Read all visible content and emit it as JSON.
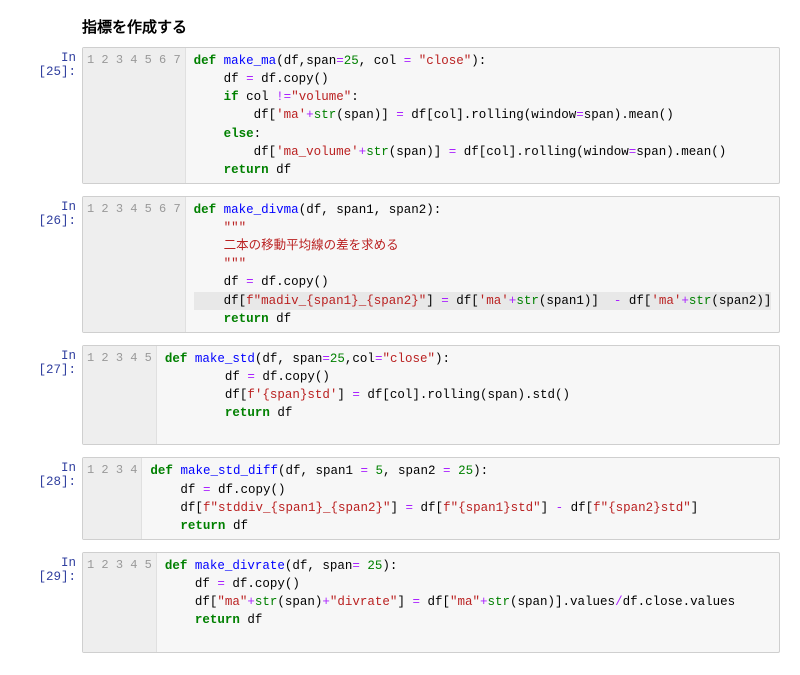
{
  "heading": "指標を作成する",
  "cells": [
    {
      "prompt": "In [25]:",
      "lines": [
        "1",
        "2",
        "3",
        "4",
        "5",
        "6",
        "7"
      ],
      "tokens": {
        "def": "def",
        "name": "make_ma",
        "sig_open": "(df,span",
        "eq1": "=",
        "arg25": "25",
        "argcol": ", col ",
        "eq2": "=",
        "close": " \"close\"",
        "sig_close": "):",
        "l2a": "    df ",
        "eq3": "=",
        "l2b": " df.copy()",
        "if": "    if",
        "l3a": " col ",
        "ne": "!=",
        "volstr": "\"volume\"",
        "colon": ":",
        "l4a": "        df[",
        "mastr": "'ma'",
        "plus": "+",
        "strcall": "str",
        "l4b": "(span)] ",
        "eq4": "=",
        "l4c": " df[col].rolling(window",
        "eq5": "=",
        "l4d": "span).mean()",
        "else": "    else",
        "l6a": "        df[",
        "mavol": "'ma_volume'",
        "l6b": "(span)] ",
        "l6c": " df[col].rolling(window",
        "l6d": "span).mean()",
        "ret": "    return",
        "retv": " df"
      }
    },
    {
      "prompt": "In [26]:",
      "lines": [
        "1",
        "2",
        "3",
        "4",
        "5",
        "6",
        "7"
      ],
      "tokens": {
        "def": "def",
        "name": "make_divma",
        "sig": "(df, span1, span2):",
        "doc1": "    \"\"\"",
        "docj": "    二本の移動平均線の差を求める",
        "doc2": "    \"\"\"",
        "l5a": "    df ",
        "eq": "=",
        "l5b": " df.copy()",
        "l6a": "    df[",
        "fstr": "f\"madiv_",
        "br1": "{span1}",
        "us": "_",
        "br2": "{span2}",
        "fend": "\"",
        "l6b": "] ",
        "l6c": " df[",
        "ma": "'ma'",
        "plus": "+",
        "str": "str",
        "sp1": "(span1)]  ",
        "minus": "-",
        "sp2a": " df[",
        "sp2": "(span2)]",
        "ret": "    return",
        "retv": " df"
      }
    },
    {
      "prompt": "In [27]:",
      "lines": [
        "1",
        "2",
        "3",
        "4",
        "5"
      ],
      "tokens": {
        "def": "def",
        "name": "make_std",
        "sig_open": "(df, span",
        "eq1": "=",
        "n25": "25",
        "sig_mid": ",col",
        "eq2": "=",
        "close": "\"close\"",
        "sig_close": "):",
        "l2a": "        df ",
        "eq3": "=",
        "l2b": " df.copy()",
        "l3a": "        df[",
        "fstr": "f'",
        "br": "{span}",
        "std": "std'",
        "l3b": "] ",
        "eq4": "=",
        "l3c": " df[col].rolling(span).std()",
        "ret": "        return",
        "retv": " df",
        "blank": " "
      }
    },
    {
      "prompt": "In [28]:",
      "lines": [
        "1",
        "2",
        "3",
        "4"
      ],
      "tokens": {
        "def": "def",
        "name": "make_std_diff",
        "sig_open": "(df, span1 ",
        "eq1": "=",
        "n5": " 5",
        "sig_mid": ", span2 ",
        "eq2": "=",
        "n25": " 25",
        "sig_close": "):",
        "l2a": "    df ",
        "eq3": "=",
        "l2b": " df.copy()",
        "l3a": "    df[",
        "f1": "f\"stddiv_",
        "b1": "{span1}",
        "us": "_",
        "b2": "{span2}",
        "f1e": "\"",
        "l3b": "] ",
        "eq4": "=",
        "l3c": " df[",
        "f2": "f\"",
        "b3": "{span1}",
        "std1": "std\"",
        "l3d": "] ",
        "minus": "-",
        "l3e": " df[",
        "f3": "f\"",
        "b4": "{span2}",
        "std2": "std\"",
        "l3f": "]",
        "ret": "    return",
        "retv": " df"
      }
    },
    {
      "prompt": "In [29]:",
      "lines": [
        "1",
        "2",
        "3",
        "4",
        "5"
      ],
      "tokens": {
        "def": "def",
        "name": "make_divrate",
        "sig_open": "(df, span",
        "eq1": "=",
        "n25": " 25",
        "sig_close": "):",
        "l2a": "    df ",
        "eq2": "=",
        "l2b": " df.copy()",
        "l3a": "    df[",
        "ma": "\"ma\"",
        "plus": "+",
        "str": "str",
        "sp": "(span)",
        "divr": "\"divrate\"",
        "l3b": "] ",
        "eq3": "=",
        "l3c": " df[",
        "l3d": "(span)].values",
        "slash": "/",
        "l3e": "df.close.values",
        "ret": "    return",
        "retv": " df",
        "blank": " "
      }
    }
  ]
}
